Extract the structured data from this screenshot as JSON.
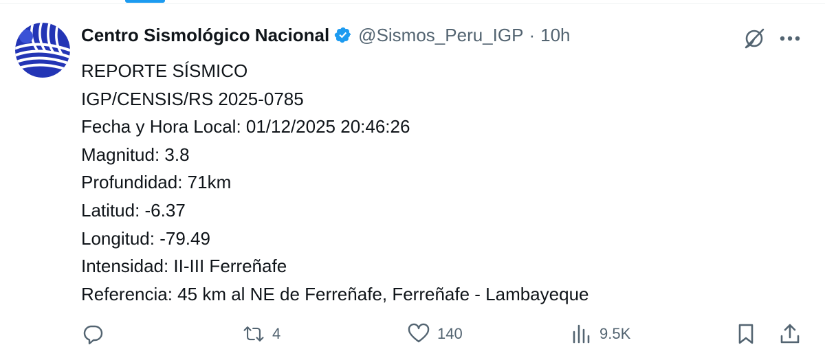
{
  "tweet": {
    "author_name": "Centro Sismológico Nacional",
    "handle": "@Sismos_Peru_IGP",
    "separator": "·",
    "time": "10h",
    "lines": [
      "REPORTE SÍSMICO",
      "IGP/CENSIS/RS 2025-0785",
      "Fecha y Hora Local: 01/12/2025 20:46:26",
      "Magnitud: 3.8",
      "Profundidad: 71km",
      "Latitud: -6.37",
      "Longitud: -79.49",
      "Intensidad: II-III Ferreñafe",
      "Referencia: 45 km al NE de Ferreñafe, Ferreñafe - Lambayeque"
    ]
  },
  "actions": {
    "reply_count": "",
    "retweet_count": "4",
    "like_count": "140",
    "views_count": "9.5K"
  },
  "icons": {
    "avatar": "seismic-logo",
    "verified": "verified-badge-icon",
    "grok": "grok-icon",
    "more": "more-icon",
    "reply": "reply-icon",
    "retweet": "retweet-icon",
    "like": "heart-icon",
    "views": "views-icon",
    "bookmark": "bookmark-icon",
    "share": "share-icon"
  },
  "colors": {
    "text": "#0f1419",
    "secondary": "#536471",
    "accent": "#1d9bf0",
    "logo_blue": "#2233b0"
  }
}
